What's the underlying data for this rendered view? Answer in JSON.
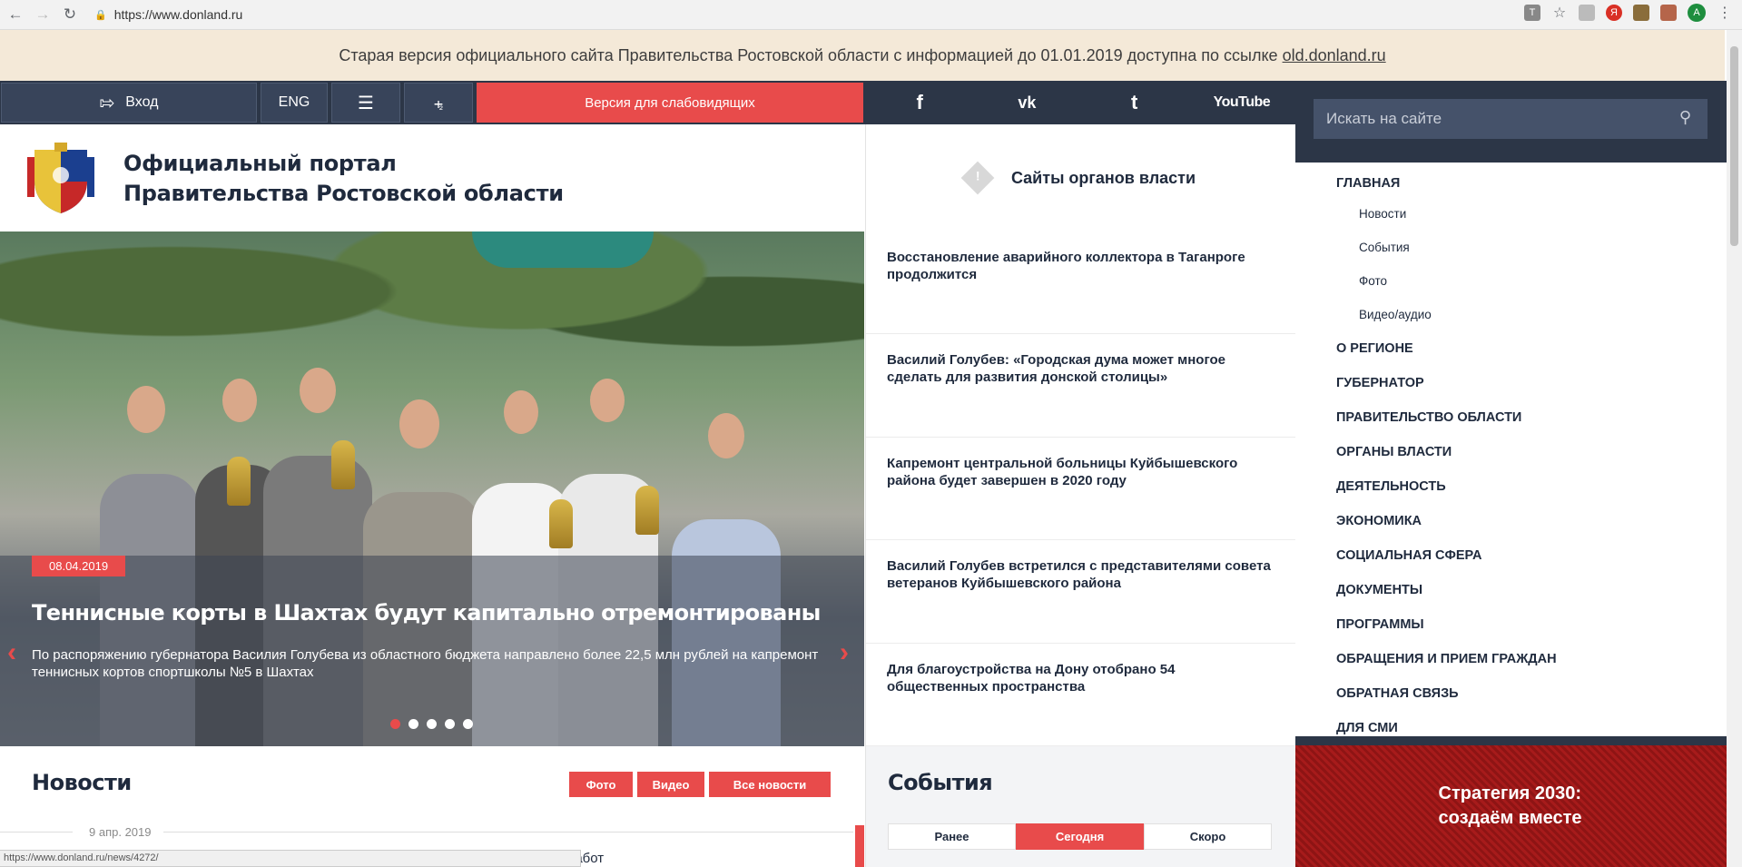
{
  "browser": {
    "url": "https://www.donland.ru",
    "status_url": "https://www.donland.ru/news/4272/",
    "profile_initial": "A"
  },
  "notice": {
    "text": "Старая версия официального сайта Правительства Ростовской области с информацией до 01.01.2019 доступна по ссылке",
    "link": "old.donland.ru"
  },
  "toolbar": {
    "login": "Вход",
    "eng": "ENG",
    "low_vision": "Версия для слабовидящих",
    "social": [
      "f",
      "vk",
      "t",
      "YouTube"
    ]
  },
  "search": {
    "placeholder": "Искать на сайте"
  },
  "header": {
    "title_line1": "Официальный портал",
    "title_line2": "Правительства Ростовской области"
  },
  "authorities": {
    "label": "Сайты органов власти"
  },
  "slider": {
    "date": "08.04.2019",
    "title": "Теннисные корты в Шахтах будут капитально отремонтированы",
    "description": "По распоряжению губернатора Василия Голубева из областного бюджета направлено более 22,5 млн рублей на капремонт теннисных кортов спортшколы №5 в Шахтах",
    "active_index": 0,
    "count": 5
  },
  "news_list": [
    "Восстановление аварийного коллектора в Таганроге продолжится",
    "Василий Голубев: «Городская дума может многое сделать для развития донской столицы»",
    "Капремонт центральной больницы Куйбышевского района будет завершен в 2020 году",
    "Василий Голубев встретился с представителями совета ветеранов Куйбышевского района",
    "Для благоустройства на Дону отобрано 54 общественных пространства"
  ],
  "menu": {
    "main": "ГЛАВНАЯ",
    "sub": [
      "Новости",
      "События",
      "Фото",
      "Видео/аудио"
    ],
    "items": [
      "О РЕГИОНЕ",
      "ГУБЕРНАТОР",
      "ПРАВИТЕЛЬСТВО ОБЛАСТИ",
      "ОРГАНЫ ВЛАСТИ",
      "ДЕЯТЕЛЬНОСТЬ",
      "ЭКОНОМИКА",
      "СОЦИАЛЬНАЯ СФЕРА",
      "ДОКУМЕНТЫ",
      "ПРОГРАММЫ",
      "ОБРАЩЕНИЯ И ПРИЕМ ГРАЖДАН",
      "ОБРАТНАЯ СВЯЗЬ",
      "ДЛЯ СМИ"
    ]
  },
  "strategy": {
    "line1": "Стратегия 2030:",
    "line2": "создаём вместе"
  },
  "news_section": {
    "title": "Новости",
    "btn_photo": "Фото",
    "btn_video": "Видео",
    "btn_all": "Все новости",
    "date": "9 апр. 2019",
    "snippet": "работ"
  },
  "events": {
    "title": "События",
    "tabs": [
      "Ранее",
      "Сегодня",
      "Скоро"
    ],
    "active_tab": 1
  },
  "colors": {
    "accent": "#e84b4b",
    "dark": "#2c3647",
    "notice_bg": "#f4e9d8"
  }
}
